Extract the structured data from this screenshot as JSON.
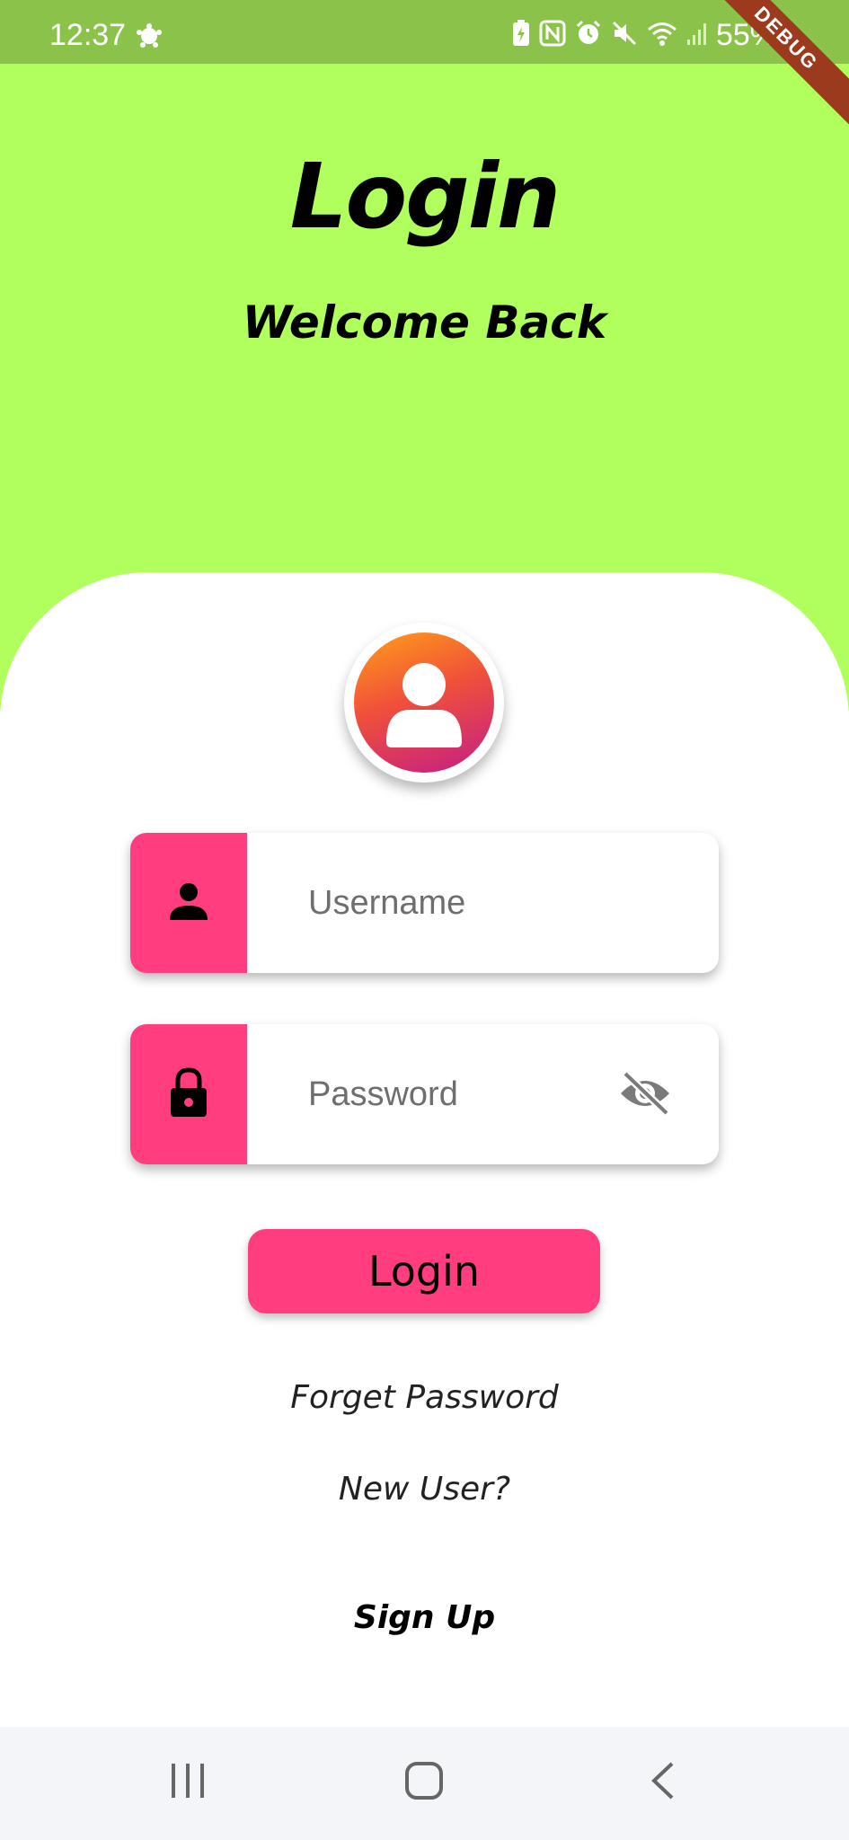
{
  "status_bar": {
    "time": "12:37",
    "battery": "55%",
    "icons": [
      "settings-icon",
      "battery-saver-icon",
      "nfc-icon",
      "alarm-icon",
      "mute-icon",
      "wifi-icon",
      "signal-icon"
    ]
  },
  "debug_banner": "DEBUG",
  "header": {
    "title": "Login",
    "subtitle": "Welcome Back"
  },
  "form": {
    "username_placeholder": "Username",
    "password_placeholder": "Password",
    "login_label": "Login"
  },
  "links": {
    "forget_password": "Forget Password",
    "new_user": "New User?",
    "sign_up": "Sign Up"
  },
  "colors": {
    "status_bar": "#8bc34a",
    "hero_background": "#b0ff5c",
    "accent": "#ff3d7f",
    "debug_banner": "#9c3a1e"
  }
}
